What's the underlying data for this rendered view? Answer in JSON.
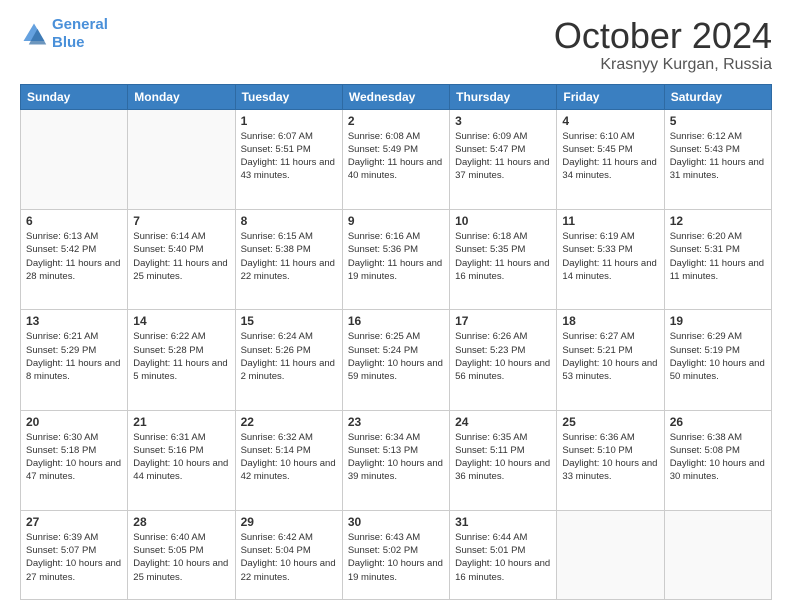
{
  "header": {
    "logo_line1": "General",
    "logo_line2": "Blue",
    "month": "October 2024",
    "location": "Krasnyy Kurgan, Russia"
  },
  "weekdays": [
    "Sunday",
    "Monday",
    "Tuesday",
    "Wednesday",
    "Thursday",
    "Friday",
    "Saturday"
  ],
  "weeks": [
    [
      {
        "day": "",
        "text": ""
      },
      {
        "day": "",
        "text": ""
      },
      {
        "day": "1",
        "text": "Sunrise: 6:07 AM\nSunset: 5:51 PM\nDaylight: 11 hours and 43 minutes."
      },
      {
        "day": "2",
        "text": "Sunrise: 6:08 AM\nSunset: 5:49 PM\nDaylight: 11 hours and 40 minutes."
      },
      {
        "day": "3",
        "text": "Sunrise: 6:09 AM\nSunset: 5:47 PM\nDaylight: 11 hours and 37 minutes."
      },
      {
        "day": "4",
        "text": "Sunrise: 6:10 AM\nSunset: 5:45 PM\nDaylight: 11 hours and 34 minutes."
      },
      {
        "day": "5",
        "text": "Sunrise: 6:12 AM\nSunset: 5:43 PM\nDaylight: 11 hours and 31 minutes."
      }
    ],
    [
      {
        "day": "6",
        "text": "Sunrise: 6:13 AM\nSunset: 5:42 PM\nDaylight: 11 hours and 28 minutes."
      },
      {
        "day": "7",
        "text": "Sunrise: 6:14 AM\nSunset: 5:40 PM\nDaylight: 11 hours and 25 minutes."
      },
      {
        "day": "8",
        "text": "Sunrise: 6:15 AM\nSunset: 5:38 PM\nDaylight: 11 hours and 22 minutes."
      },
      {
        "day": "9",
        "text": "Sunrise: 6:16 AM\nSunset: 5:36 PM\nDaylight: 11 hours and 19 minutes."
      },
      {
        "day": "10",
        "text": "Sunrise: 6:18 AM\nSunset: 5:35 PM\nDaylight: 11 hours and 16 minutes."
      },
      {
        "day": "11",
        "text": "Sunrise: 6:19 AM\nSunset: 5:33 PM\nDaylight: 11 hours and 14 minutes."
      },
      {
        "day": "12",
        "text": "Sunrise: 6:20 AM\nSunset: 5:31 PM\nDaylight: 11 hours and 11 minutes."
      }
    ],
    [
      {
        "day": "13",
        "text": "Sunrise: 6:21 AM\nSunset: 5:29 PM\nDaylight: 11 hours and 8 minutes."
      },
      {
        "day": "14",
        "text": "Sunrise: 6:22 AM\nSunset: 5:28 PM\nDaylight: 11 hours and 5 minutes."
      },
      {
        "day": "15",
        "text": "Sunrise: 6:24 AM\nSunset: 5:26 PM\nDaylight: 11 hours and 2 minutes."
      },
      {
        "day": "16",
        "text": "Sunrise: 6:25 AM\nSunset: 5:24 PM\nDaylight: 10 hours and 59 minutes."
      },
      {
        "day": "17",
        "text": "Sunrise: 6:26 AM\nSunset: 5:23 PM\nDaylight: 10 hours and 56 minutes."
      },
      {
        "day": "18",
        "text": "Sunrise: 6:27 AM\nSunset: 5:21 PM\nDaylight: 10 hours and 53 minutes."
      },
      {
        "day": "19",
        "text": "Sunrise: 6:29 AM\nSunset: 5:19 PM\nDaylight: 10 hours and 50 minutes."
      }
    ],
    [
      {
        "day": "20",
        "text": "Sunrise: 6:30 AM\nSunset: 5:18 PM\nDaylight: 10 hours and 47 minutes."
      },
      {
        "day": "21",
        "text": "Sunrise: 6:31 AM\nSunset: 5:16 PM\nDaylight: 10 hours and 44 minutes."
      },
      {
        "day": "22",
        "text": "Sunrise: 6:32 AM\nSunset: 5:14 PM\nDaylight: 10 hours and 42 minutes."
      },
      {
        "day": "23",
        "text": "Sunrise: 6:34 AM\nSunset: 5:13 PM\nDaylight: 10 hours and 39 minutes."
      },
      {
        "day": "24",
        "text": "Sunrise: 6:35 AM\nSunset: 5:11 PM\nDaylight: 10 hours and 36 minutes."
      },
      {
        "day": "25",
        "text": "Sunrise: 6:36 AM\nSunset: 5:10 PM\nDaylight: 10 hours and 33 minutes."
      },
      {
        "day": "26",
        "text": "Sunrise: 6:38 AM\nSunset: 5:08 PM\nDaylight: 10 hours and 30 minutes."
      }
    ],
    [
      {
        "day": "27",
        "text": "Sunrise: 6:39 AM\nSunset: 5:07 PM\nDaylight: 10 hours and 27 minutes."
      },
      {
        "day": "28",
        "text": "Sunrise: 6:40 AM\nSunset: 5:05 PM\nDaylight: 10 hours and 25 minutes."
      },
      {
        "day": "29",
        "text": "Sunrise: 6:42 AM\nSunset: 5:04 PM\nDaylight: 10 hours and 22 minutes."
      },
      {
        "day": "30",
        "text": "Sunrise: 6:43 AM\nSunset: 5:02 PM\nDaylight: 10 hours and 19 minutes."
      },
      {
        "day": "31",
        "text": "Sunrise: 6:44 AM\nSunset: 5:01 PM\nDaylight: 10 hours and 16 minutes."
      },
      {
        "day": "",
        "text": ""
      },
      {
        "day": "",
        "text": ""
      }
    ]
  ]
}
